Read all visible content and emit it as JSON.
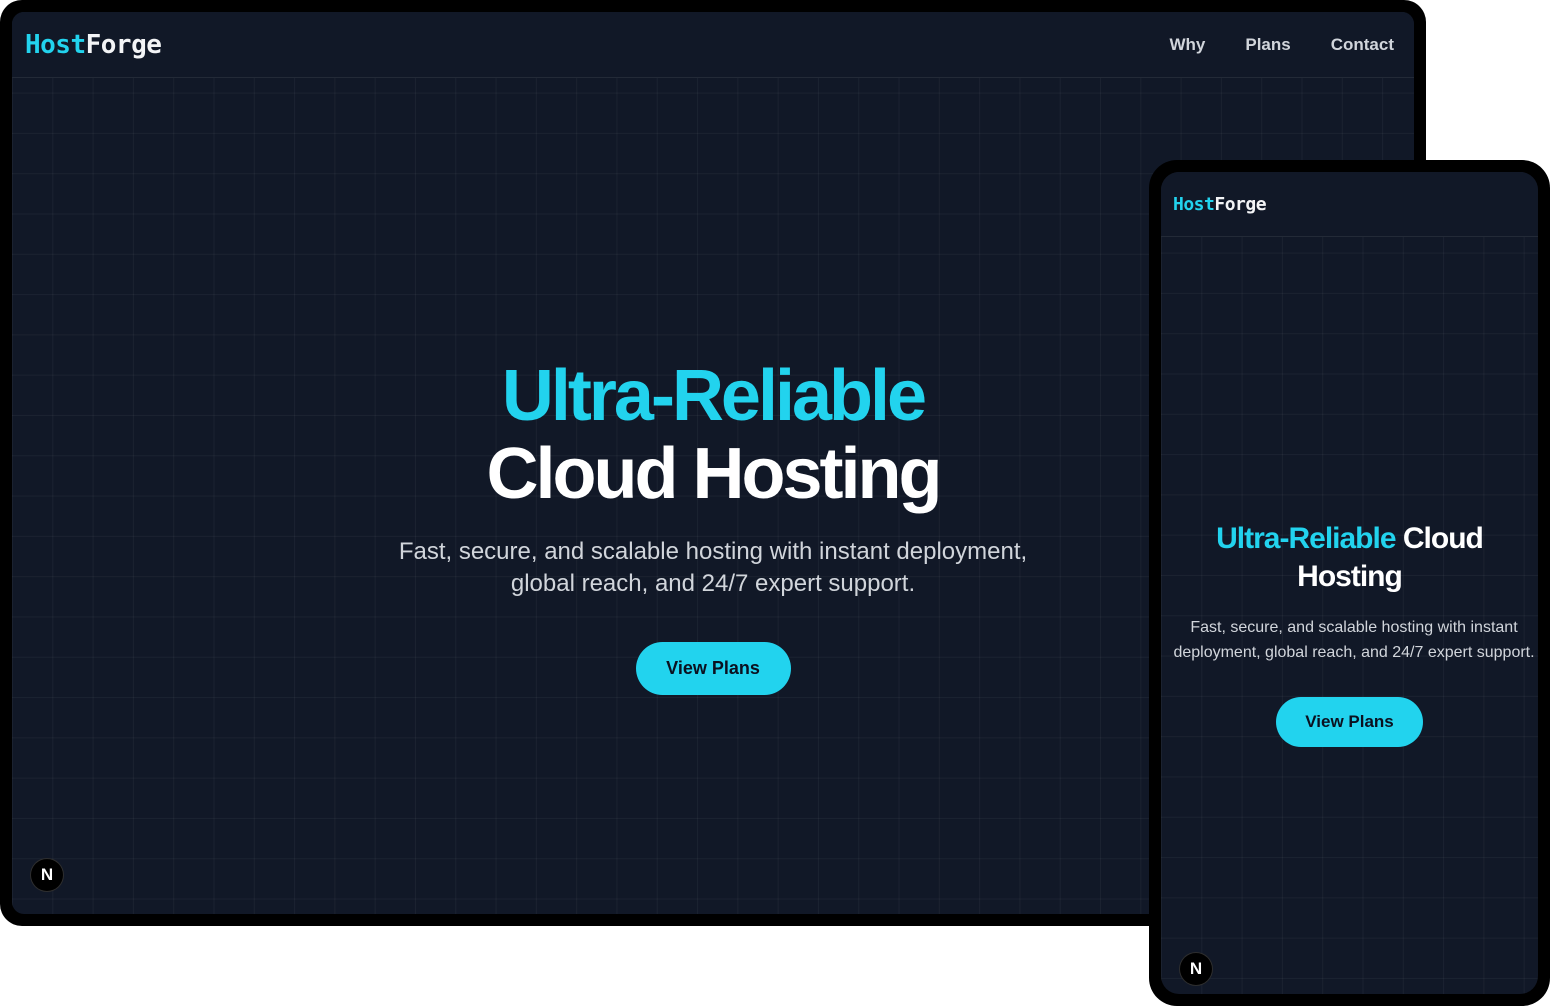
{
  "brand": {
    "part1": "Host",
    "part2": "Forge"
  },
  "nav": {
    "items": [
      {
        "label": "Why"
      },
      {
        "label": "Plans"
      },
      {
        "label": "Contact"
      }
    ]
  },
  "hero": {
    "title_accent": "Ultra-Reliable",
    "title_main": "Cloud Hosting",
    "subtitle": "Fast, secure, and scalable hosting with instant deployment, global reach, and 24/7 expert support.",
    "cta_label": "View Plans"
  },
  "badge": {
    "label": "N",
    "icon": "nextjs-logo-icon"
  },
  "colors": {
    "accent": "#22d3ee",
    "background": "#111827",
    "text_muted": "#d1d5db"
  }
}
